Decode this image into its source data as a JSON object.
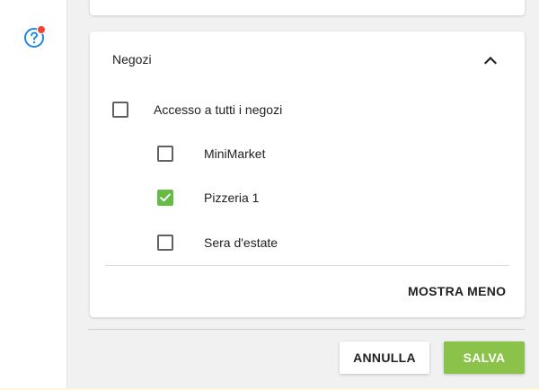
{
  "sidebar": {
    "help_icon": "help-circle-icon",
    "notification_color": "#f44336",
    "icon_color": "#1e88e5"
  },
  "stores_card": {
    "title": "Negozi",
    "collapse_icon": "chevron-up-icon",
    "all_stores": {
      "label": "Accesso a tutti i negozi",
      "checked": false
    },
    "stores": [
      {
        "label": "MiniMarket",
        "checked": false
      },
      {
        "label": "Pizzeria 1",
        "checked": true
      },
      {
        "label": "Sera d'estate",
        "checked": false
      }
    ],
    "show_less_label": "MOSTRA MENO"
  },
  "actions": {
    "cancel_label": "ANNULLA",
    "save_label": "SALVA",
    "save_color": "#8bc34a",
    "check_color": "#66bb44"
  }
}
